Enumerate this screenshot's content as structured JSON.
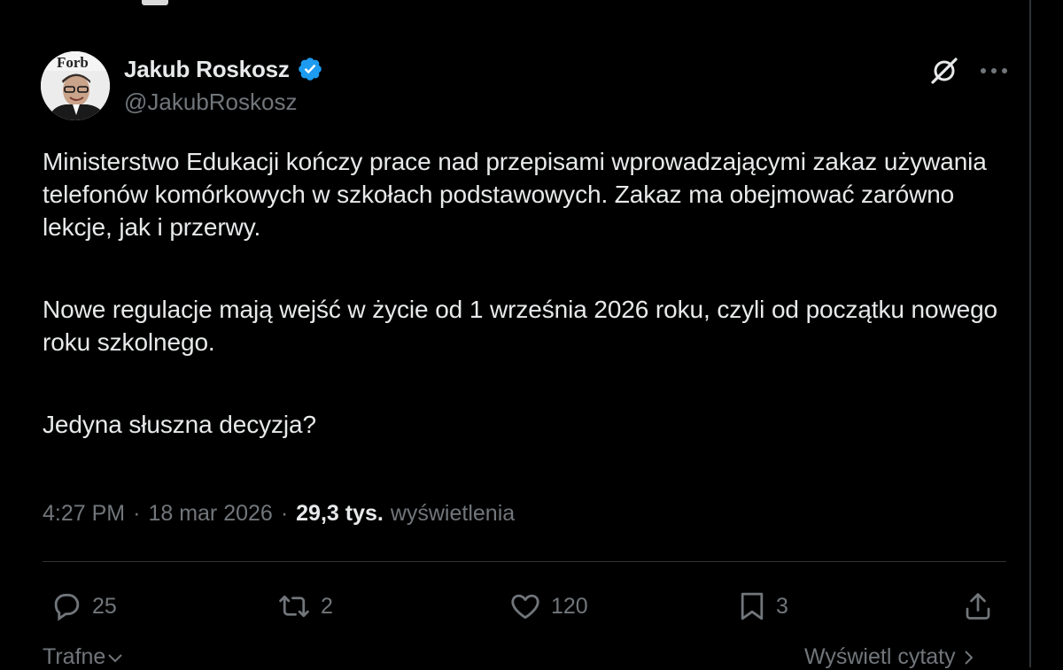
{
  "author": {
    "name": "Jakub Roskosz",
    "handle": "@JakubRoskosz",
    "avatar_text": "Forb"
  },
  "post": {
    "paragraphs": [
      "Ministerstwo Edukacji kończy prace nad przepisami wprowadzającymi zakaz używania telefonów komórkowych w szkołach podstawowych. Zakaz ma obejmować zarówno lekcje, jak i przerwy.",
      "Nowe regulacje mają wejść w życie od 1 września 2026 roku, czyli od początku nowego roku szkolnego.",
      "Jedyna słuszna decyzja?"
    ],
    "time": "4:27 PM",
    "date": "18 mar 2026",
    "views_count": "29,3 tys.",
    "views_label": "wyświetlenia"
  },
  "actions": {
    "replies": "25",
    "reposts": "2",
    "likes": "120",
    "bookmarks": "3"
  },
  "footer": {
    "sort_label": "Trafne",
    "quotes_label": "Wyświetl cytaty"
  },
  "colors": {
    "background": "#000000",
    "text": "#e7e9ea",
    "muted": "#71767b",
    "verified": "#1d9bf0",
    "divider": "#2f3336"
  }
}
